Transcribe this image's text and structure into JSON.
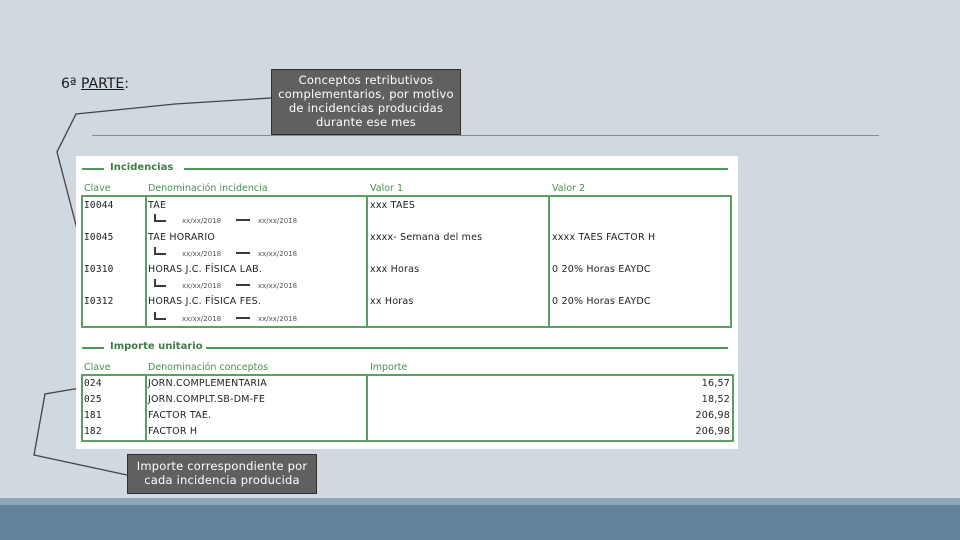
{
  "heading": {
    "prefix": "6ª ",
    "underlined": "PARTE",
    "suffix": ":"
  },
  "callouts": {
    "top": "Conceptos retributivos complementarios, por motivo de incidencias producidas durante ese mes",
    "bottom": "Importe correspondiente por cada incidencia producida"
  },
  "incidencias": {
    "title": "Incidencias",
    "headers": [
      "Clave",
      "Denominación incidencia",
      "Valor 1",
      "Valor 2"
    ],
    "rows": [
      {
        "clave": "I0044",
        "denominacion": "TAE",
        "valor1": "xxx TAES",
        "valor2": "",
        "fecha_inicio": "xx/xx/2018",
        "fecha_fin": "xx/xx/2018"
      },
      {
        "clave": "I0045",
        "denominacion": "TAE HORARIO",
        "valor1": "xxxx- Semana del mes",
        "valor2": "xxxx TAES FACTOR H",
        "fecha_inicio": "xx/xx/2018",
        "fecha_fin": "xx/xx/2018"
      },
      {
        "clave": "I0310",
        "denominacion": "HORAS J.C. FÍSICA LAB.",
        "valor1": "xxx Horas",
        "valor2": "0 20% Horas EAYDC",
        "fecha_inicio": "xx/xx/2018",
        "fecha_fin": "xx/xx/2018"
      },
      {
        "clave": "I0312",
        "denominacion": "HORAS J.C. FÍSICA FES.",
        "valor1": "xx Horas",
        "valor2": "0 20% Horas EAYDC",
        "fecha_inicio": "xx/xx/2018",
        "fecha_fin": "xx/xx/2018"
      }
    ]
  },
  "importe": {
    "title": "Importe unitario",
    "headers": [
      "Clave",
      "Denominación conceptos",
      "Importe"
    ],
    "rows": [
      {
        "clave": "024",
        "concepto": "JORN.COMPLEMENTARIA",
        "importe": "16,57"
      },
      {
        "clave": "025",
        "concepto": "JORN.COMPLT.SB-DM-FE",
        "importe": "18,52"
      },
      {
        "clave": "181",
        "concepto": "FACTOR TAE.",
        "importe": "206,98"
      },
      {
        "clave": "182",
        "concepto": "FACTOR H",
        "importe": "206,98"
      }
    ]
  },
  "colors": {
    "accent_green": "#5d9e62",
    "callout_bg": "#606060",
    "slide_bg": "#d0d8e0",
    "footer_bar": "#64829a"
  }
}
